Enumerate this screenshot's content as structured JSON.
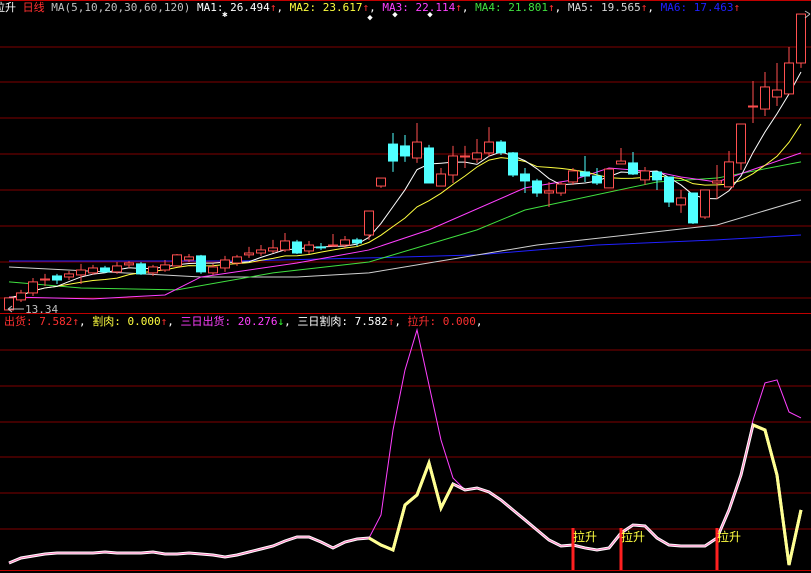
{
  "header": {
    "prefix": "拉升",
    "period": "日线",
    "ma_params": "MA(5,10,20,30,60,120)",
    "ma_items": [
      {
        "label": "MA1:",
        "value": "26.494",
        "arrow": "↑",
        "sep": ",",
        "color": "#ffffff"
      },
      {
        "label": "MA2:",
        "value": "23.617",
        "arrow": "↑",
        "sep": ",",
        "color": "#ffff40"
      },
      {
        "label": "MA3:",
        "value": "22.114",
        "arrow": "↑",
        "sep": ",",
        "color": "#ff40ff"
      },
      {
        "label": "MA4:",
        "value": "21.801",
        "arrow": "↑",
        "sep": ",",
        "color": "#40e040"
      },
      {
        "label": "MA5:",
        "value": "19.565",
        "arrow": "↑",
        "sep": ",",
        "color": "#d8d8d8"
      },
      {
        "label": "MA6:",
        "value": "17.463",
        "arrow": "↑",
        "sep": "",
        "color": "#2020ff"
      }
    ]
  },
  "indicator": {
    "items": [
      {
        "label": "出货:",
        "value": "7.582",
        "arrow": "↑",
        "sep": ",",
        "color": "#ff3030",
        "arrow_dir": "up"
      },
      {
        "label": "割肉:",
        "value": "0.000",
        "arrow": "↑",
        "sep": ",",
        "color": "#ffff40",
        "arrow_dir": "up"
      },
      {
        "label": "三日出货:",
        "value": "20.276",
        "arrow": "↓",
        "sep": ",",
        "color": "#ff40ff",
        "arrow_dir": "down"
      },
      {
        "label": "三日割肉:",
        "value": "7.582",
        "arrow": "↑",
        "sep": ",",
        "color": "#ffffff",
        "arrow_dir": "up"
      },
      {
        "label": "拉升:",
        "value": "0.000",
        "arrow": "",
        "sep": ",",
        "color": "#ff3030",
        "arrow_dir": "none"
      }
    ],
    "signal_label": "拉升"
  },
  "low_label": "13.34",
  "colors": {
    "up": "#ff5050",
    "down": "#50ffff",
    "grid": "#800000",
    "border": "#c00000"
  },
  "chart_data": [
    {
      "type": "candlestick",
      "title": "日线",
      "ylim": [
        13.16,
        31.4
      ],
      "ohlc": [
        [
          13.34,
          14.05,
          13.34,
          14.05
        ],
        [
          13.93,
          14.52,
          13.81,
          14.34
        ],
        [
          14.34,
          15.22,
          14.16,
          14.99
        ],
        [
          15.1,
          15.46,
          14.75,
          15.16
        ],
        [
          15.34,
          15.46,
          14.87,
          15.1
        ],
        [
          15.28,
          15.63,
          15.1,
          15.46
        ],
        [
          15.4,
          16.05,
          14.87,
          15.69
        ],
        [
          15.52,
          15.99,
          15.4,
          15.81
        ],
        [
          15.81,
          15.93,
          15.52,
          15.58
        ],
        [
          15.58,
          16.16,
          15.46,
          15.93
        ],
        [
          15.99,
          16.22,
          15.81,
          16.1
        ],
        [
          16.05,
          16.16,
          15.4,
          15.46
        ],
        [
          15.52,
          15.99,
          15.34,
          15.87
        ],
        [
          15.69,
          16.28,
          15.58,
          15.99
        ],
        [
          15.93,
          16.63,
          15.93,
          16.58
        ],
        [
          16.28,
          16.63,
          16.16,
          16.46
        ],
        [
          16.52,
          16.58,
          15.46,
          15.58
        ],
        [
          15.52,
          16.05,
          15.4,
          15.87
        ],
        [
          15.81,
          16.52,
          15.58,
          16.28
        ],
        [
          16.1,
          16.58,
          15.93,
          16.46
        ],
        [
          16.58,
          17.05,
          16.4,
          16.69
        ],
        [
          16.69,
          17.16,
          16.52,
          16.87
        ],
        [
          16.81,
          17.46,
          16.69,
          16.99
        ],
        [
          16.87,
          17.87,
          16.75,
          17.4
        ],
        [
          17.34,
          17.46,
          16.63,
          16.69
        ],
        [
          16.81,
          17.4,
          16.63,
          17.16
        ],
        [
          17.05,
          17.28,
          16.87,
          16.99
        ],
        [
          17.1,
          17.81,
          17.05,
          17.16
        ],
        [
          17.16,
          17.69,
          16.99,
          17.46
        ],
        [
          17.46,
          17.58,
          17.1,
          17.28
        ],
        [
          17.75,
          19.16,
          17.46,
          19.16
        ],
        [
          20.63,
          21.1,
          20.52,
          21.1
        ],
        [
          23.1,
          23.75,
          21.46,
          22.1
        ],
        [
          22.99,
          23.63,
          22.05,
          22.4
        ],
        [
          22.28,
          24.34,
          21.99,
          23.22
        ],
        [
          22.87,
          23.05,
          20.81,
          20.81
        ],
        [
          20.63,
          21.69,
          20.63,
          21.34
        ],
        [
          21.28,
          22.99,
          20.81,
          22.4
        ],
        [
          22.34,
          22.99,
          21.69,
          22.4
        ],
        [
          22.22,
          23.4,
          21.99,
          22.58
        ],
        [
          22.58,
          24.1,
          22.34,
          23.22
        ],
        [
          23.22,
          23.34,
          22.46,
          22.58
        ],
        [
          22.58,
          22.63,
          21.16,
          21.28
        ],
        [
          21.34,
          21.69,
          20.22,
          20.93
        ],
        [
          20.93,
          21.05,
          19.99,
          20.22
        ],
        [
          20.22,
          20.87,
          19.4,
          20.34
        ],
        [
          20.22,
          20.87,
          20.05,
          20.75
        ],
        [
          20.87,
          21.69,
          20.69,
          21.52
        ],
        [
          21.46,
          22.4,
          20.87,
          21.22
        ],
        [
          21.22,
          21.69,
          20.69,
          20.81
        ],
        [
          20.52,
          21.63,
          20.52,
          21.63
        ],
        [
          21.93,
          22.87,
          21.93,
          22.1
        ],
        [
          21.99,
          22.63,
          21.28,
          21.34
        ],
        [
          20.99,
          21.75,
          20.69,
          21.52
        ],
        [
          21.46,
          21.46,
          20.4,
          20.99
        ],
        [
          21.16,
          21.16,
          19.4,
          19.69
        ],
        [
          19.52,
          20.4,
          19.05,
          19.93
        ],
        [
          20.22,
          20.22,
          18.4,
          18.46
        ],
        [
          18.81,
          20.4,
          18.69,
          20.4
        ],
        [
          20.81,
          21.87,
          19.87,
          20.93
        ],
        [
          20.58,
          22.69,
          20.58,
          22.05
        ],
        [
          21.99,
          24.28,
          21.58,
          24.28
        ],
        [
          25.28,
          26.81,
          24.34,
          25.34
        ],
        [
          25.16,
          27.34,
          24.75,
          26.46
        ],
        [
          25.87,
          27.87,
          25.34,
          26.28
        ],
        [
          26.05,
          28.81,
          26.05,
          27.87
        ],
        [
          27.87,
          30.75,
          27.58,
          30.75
        ]
      ],
      "ma_computed": [
        {
          "name": "MA1",
          "period": 5,
          "color": "#ffffff"
        },
        {
          "name": "MA2",
          "period": 10,
          "color": "#ffff40"
        }
      ],
      "ma_series": [
        {
          "name": "MA3",
          "color": "#ff40ff",
          "points": [
            [
              1,
              14.1
            ],
            [
              8,
              13.99
            ],
            [
              14,
              14.22
            ],
            [
              17,
              15.28
            ],
            [
              25,
              16.1
            ],
            [
              31,
              16.87
            ],
            [
              36,
              18.05
            ],
            [
              44,
              20.52
            ],
            [
              48,
              20.99
            ],
            [
              51,
              21.69
            ],
            [
              55,
              21.46
            ],
            [
              57,
              21.16
            ],
            [
              60,
              20.87
            ],
            [
              67,
              22.58
            ]
          ]
        },
        {
          "name": "MA4",
          "color": "#40e040",
          "points": [
            [
              1,
              14.99
            ],
            [
              7,
              14.63
            ],
            [
              15,
              14.52
            ],
            [
              23,
              15.52
            ],
            [
              31,
              16.16
            ],
            [
              40,
              18.05
            ],
            [
              44,
              19.22
            ],
            [
              55,
              20.87
            ],
            [
              60,
              21.1
            ],
            [
              67,
              22.05
            ]
          ]
        },
        {
          "name": "MA5",
          "color": "#d0d0d0",
          "points": [
            [
              1,
              15.87
            ],
            [
              9,
              15.58
            ],
            [
              17,
              15.28
            ],
            [
              25,
              15.28
            ],
            [
              31,
              15.52
            ],
            [
              45,
              17.16
            ],
            [
              60,
              18.34
            ],
            [
              67,
              19.81
            ]
          ]
        },
        {
          "name": "MA6",
          "color": "#2020ff",
          "points": [
            [
              1,
              16.22
            ],
            [
              20,
              16.22
            ],
            [
              31,
              16.4
            ],
            [
              40,
              16.58
            ],
            [
              50,
              17.16
            ],
            [
              60,
              17.46
            ],
            [
              67,
              17.75
            ]
          ]
        }
      ]
    },
    {
      "type": "line",
      "title": "indicator",
      "ylim": [
        0,
        34.1
      ],
      "series": [
        {
          "name": "三日出货",
          "color": "#ff40ff",
          "values": [
            0.41,
            1.09,
            1.36,
            1.64,
            1.77,
            1.77,
            1.77,
            1.77,
            1.91,
            1.77,
            1.77,
            1.77,
            1.91,
            1.64,
            1.64,
            1.77,
            1.64,
            1.5,
            1.23,
            1.5,
            1.91,
            2.32,
            2.73,
            3.41,
            3.96,
            3.96,
            3.27,
            2.46,
            3.27,
            3.68,
            3.82,
            6.96,
            18.55,
            26.74,
            32.2,
            24.69,
            17.19,
            12.01,
            10.37,
            10.64,
            10.1,
            9.0,
            7.64,
            6.28,
            4.91,
            3.55,
            2.73,
            2.86,
            2.46,
            2.18,
            2.46,
            4.5,
            5.59,
            5.46,
            3.82,
            2.86,
            2.73,
            2.73,
            2.73,
            3.82,
            7.64,
            12.41,
            19.92,
            24.97,
            25.38,
            21.01,
            20.19
          ]
        },
        {
          "name": "出货",
          "color": "#ff80c0",
          "values": [
            0.41,
            1.09,
            1.36,
            1.64,
            1.77,
            1.77,
            1.77,
            1.77,
            1.91,
            1.77,
            1.77,
            1.77,
            1.91,
            1.64,
            1.64,
            1.77,
            1.64,
            1.5,
            1.23,
            1.5,
            1.91,
            2.32,
            2.73,
            3.41,
            3.96,
            3.96,
            3.27,
            2.46,
            3.27,
            3.68,
            3.82,
            2.86,
            2.18,
            8.32,
            9.69,
            14.05,
            7.91,
            11.19,
            10.37,
            10.64,
            10.1,
            9.0,
            7.64,
            6.28,
            4.91,
            3.55,
            2.73,
            2.86,
            2.46,
            2.18,
            2.46,
            4.5,
            5.59,
            5.46,
            3.82,
            2.86,
            2.73,
            2.73,
            2.73,
            3.82,
            7.64,
            12.41,
            19.24,
            18.55,
            12.41,
            0.14,
            7.64
          ]
        },
        {
          "name": "三日割肉",
          "color": "#ffff90",
          "highlight_ranges": [
            [
              31,
              38
            ],
            [
              63,
              67
            ]
          ]
        }
      ],
      "signals": [
        48,
        52,
        60
      ]
    }
  ]
}
